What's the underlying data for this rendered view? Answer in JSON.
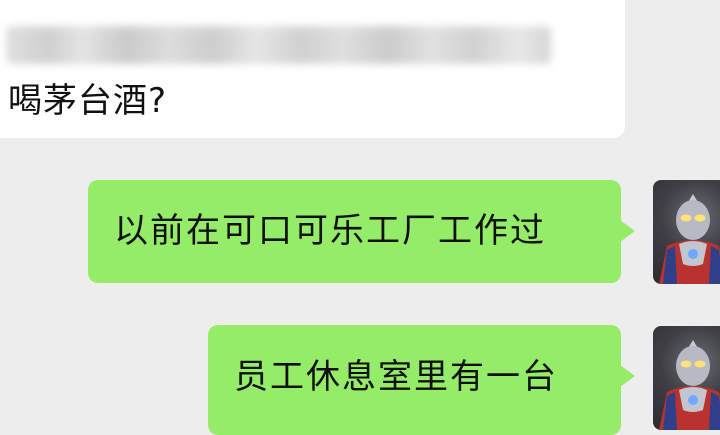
{
  "chat": {
    "messages": [
      {
        "direction": "incoming",
        "text": "喝茅台酒?"
      },
      {
        "direction": "outgoing",
        "text": "以前在可口可乐工厂工作过"
      },
      {
        "direction": "outgoing",
        "text": "员工休息室里有一台"
      }
    ],
    "avatar_icon": "ultraman-avatar-icon",
    "colors": {
      "background": "#ededed",
      "incoming_bubble": "#ffffff",
      "outgoing_bubble": "#95ec69"
    }
  }
}
